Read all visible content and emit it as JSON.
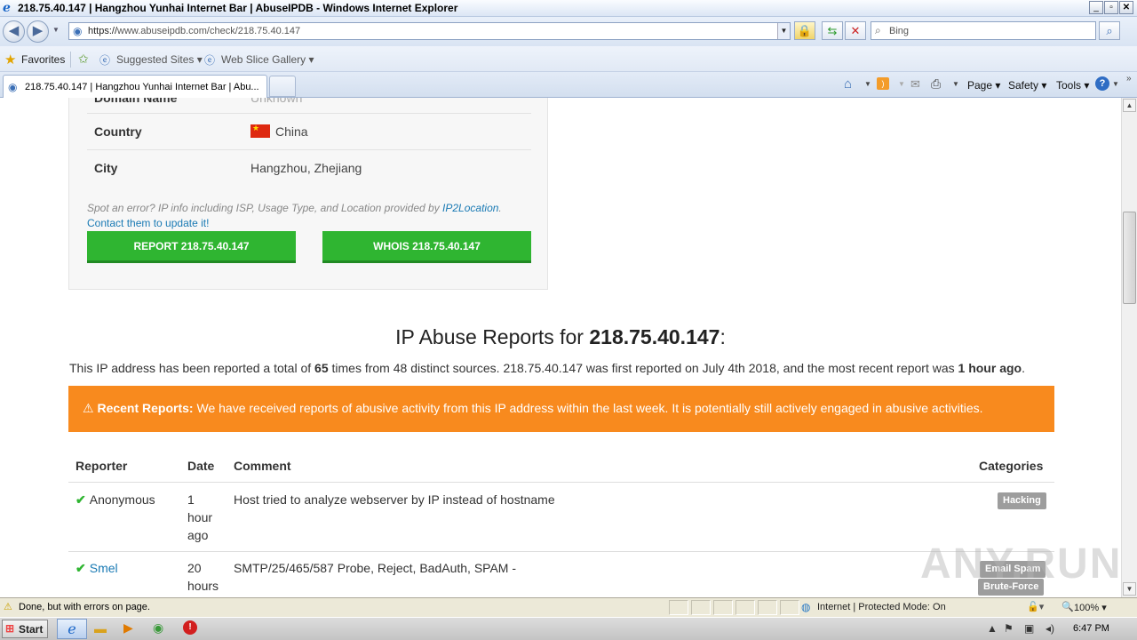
{
  "window": {
    "title": "218.75.40.147 | Hangzhou Yunhai Internet Bar | AbuseIPDB - Windows Internet Explorer"
  },
  "address_bar": {
    "url_prefix": "https://",
    "url_host": "www.abuseipdb.com",
    "url_path": "/check/218.75.40.147",
    "search_placeholder": "Bing"
  },
  "favorites_bar": {
    "favorites_label": "Favorites",
    "suggested_sites": "Suggested Sites",
    "web_slice_gallery": "Web Slice Gallery"
  },
  "tab": {
    "title": "218.75.40.147 | Hangzhou Yunhai Internet Bar | Abu..."
  },
  "command_bar": {
    "page": "Page",
    "safety": "Safety",
    "tools": "Tools"
  },
  "info_card": {
    "domain_label": "Domain Name",
    "domain_value": "Unknown",
    "country_label": "Country",
    "country_value": "China",
    "city_label": "City",
    "city_value": "Hangzhou, Zhejiang",
    "note_text": "Spot an error? IP info including ISP, Usage Type, and Location provided by ",
    "note_link": "IP2Location",
    "note_end": ".",
    "contact_link": "Contact them to update it!",
    "report_button": "REPORT 218.75.40.147",
    "whois_button": "WHOIS 218.75.40.147"
  },
  "reports": {
    "heading_prefix": "IP Abuse Reports for ",
    "heading_ip": "218.75.40.147",
    "heading_suffix": ":",
    "summary_1": "This IP address has been reported a total of ",
    "summary_count": "65",
    "summary_2": " times from 48 distinct sources. 218.75.40.147 was first reported on July 4th 2018, and the most recent report was ",
    "summary_recent": "1 hour ago",
    "summary_end": ".",
    "alert_title": "Recent Reports:",
    "alert_text": " We have received reports of abusive activity from this IP address within the last week. It is potentially still actively engaged in abusive activities.",
    "columns": [
      "Reporter",
      "Date",
      "Comment",
      "Categories"
    ],
    "rows": [
      {
        "reporter": "Anonymous",
        "date_lines": [
          "1",
          "hour",
          "ago"
        ],
        "comment": "Host tried to analyze webserver by IP instead of hostname",
        "categories": [
          "Hacking"
        ]
      },
      {
        "reporter": "Smel",
        "date_lines": [
          "20",
          "hours"
        ],
        "comment": "SMTP/25/465/587 Probe, Reject, BadAuth, SPAM -",
        "categories": [
          "Email Spam",
          "Brute-Force"
        ]
      }
    ]
  },
  "watermark": "ANY.RUN",
  "status_bar": {
    "text": "Done, but with errors on page.",
    "zone": "Internet | Protected Mode: On",
    "zoom": "100%"
  },
  "taskbar": {
    "start": "Start",
    "clock": "6:47 PM"
  },
  "colors": {
    "green_button": "#2fb531",
    "alert_orange": "#f88a1e",
    "link_blue": "#1a7ab4",
    "badge_gray": "#9d9d9d"
  }
}
